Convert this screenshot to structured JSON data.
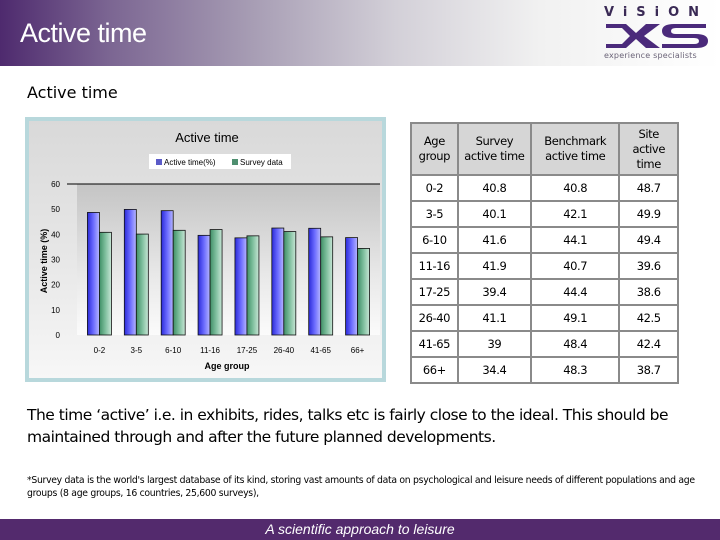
{
  "header": {
    "title": "Active time",
    "logo": {
      "brand_top": "ViSiON",
      "brand_mark": "XS",
      "tagline": "experience specialists",
      "color": "#4b2a7b"
    }
  },
  "subtitle": "Active time",
  "table": {
    "headers": [
      "Age group",
      "Survey active time",
      "Benchmark active time",
      "Site active time"
    ],
    "rows": [
      [
        "0-2",
        "40.8",
        "40.8",
        "48.7"
      ],
      [
        "3-5",
        "40.1",
        "42.1",
        "49.9"
      ],
      [
        "6-10",
        "41.6",
        "44.1",
        "49.4"
      ],
      [
        "11-16",
        "41.9",
        "40.7",
        "39.6"
      ],
      [
        "17-25",
        "39.4",
        "44.4",
        "38.6"
      ],
      [
        "26-40",
        "41.1",
        "49.1",
        "42.5"
      ],
      [
        "41-65",
        "39",
        "48.4",
        "42.4"
      ],
      [
        "66+",
        "34.4",
        "48.3",
        "38.7"
      ]
    ]
  },
  "body_text": "The time ‘active’ i.e. in exhibits, rides, talks etc is fairly close to the ideal. This should be maintained through and after the  future planned developments.",
  "footnote": "*Survey data is the world's largest database of its kind, storing vast  amounts of data on psychological and leisure needs of different populations and age groups (8 age groups, 16 countries, 25,600 surveys),",
  "footer": {
    "tagline": "A scientific approach to leisure",
    "color": "#532a6d"
  },
  "chart_data": {
    "type": "bar",
    "title": "Active time",
    "xlabel": "Age group",
    "ylabel": "Active time (%)",
    "categories": [
      "0-2",
      "3-5",
      "6-10",
      "11-16",
      "17-25",
      "26-40",
      "41-65",
      "66+"
    ],
    "series": [
      {
        "name": "Active time(%)",
        "color": "#5b5bf0",
        "values": [
          48.7,
          49.9,
          49.4,
          39.6,
          38.6,
          42.5,
          42.4,
          38.7
        ]
      },
      {
        "name": "Survey data",
        "color": "#6aaa88",
        "values": [
          40.8,
          40.1,
          41.6,
          41.9,
          39.4,
          41.1,
          39,
          34.4
        ]
      }
    ],
    "ylim": [
      0,
      60
    ],
    "yticks": [
      0,
      10,
      20,
      30,
      40,
      50,
      60
    ],
    "grid": false,
    "legend": "top-center"
  }
}
